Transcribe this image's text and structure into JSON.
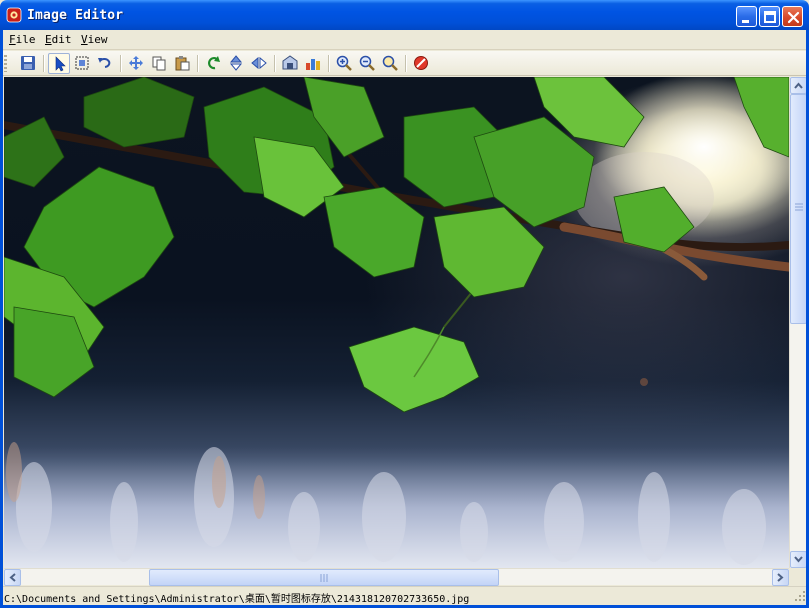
{
  "window": {
    "title": "Image Editor",
    "controls": {
      "minimize": "minimize-icon",
      "maximize": "maximize-icon",
      "close": "close-icon"
    }
  },
  "menu": {
    "items": [
      {
        "accel": "F",
        "rest": "ile"
      },
      {
        "accel": "E",
        "rest": "dit"
      },
      {
        "accel": "V",
        "rest": "iew"
      }
    ]
  },
  "toolbar": {
    "tools": [
      "save-icon",
      "pointer-icon",
      "select-rect-icon",
      "undo-icon",
      "move-icon",
      "copy-icon",
      "paste-icon",
      "rotate-icon",
      "flip-vertical-icon",
      "flip-horizontal-icon",
      "open-icon",
      "adjust-icon",
      "zoom-in-icon",
      "zoom-out-icon",
      "zoom-fit-icon",
      "stop-icon"
    ],
    "active_tool": "pointer-icon"
  },
  "image": {
    "description_colors": {
      "leaf": "#3c9a1e",
      "leaf_light": "#7fd23a",
      "branch": "#3a2418",
      "sky": "#0c1420"
    }
  },
  "scroll": {
    "vertical_position": 0.0,
    "horizontal_position": 0.19
  },
  "status": {
    "path": "C:\\Documents and Settings\\Administrator\\桌面\\暂时图标存放\\214318120702733650.jpg"
  },
  "colors": {
    "titlebar": "#0054e3",
    "chrome": "#ece9d8",
    "close_button": "#d8492a"
  }
}
